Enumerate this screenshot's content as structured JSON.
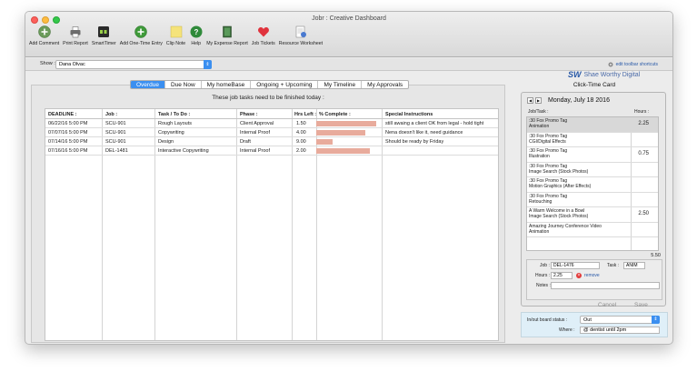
{
  "window": {
    "title": "Jobr : Creative Dashboard"
  },
  "toolbar": [
    {
      "label": "Add Comment",
      "icon": "add-comment-icon"
    },
    {
      "label": "Print Report",
      "icon": "printer-icon"
    },
    {
      "label": "SmartTimer",
      "icon": "timer-icon"
    },
    {
      "label": "Add One-Time Entry",
      "icon": "add-entry-icon"
    },
    {
      "label": "Clip Note",
      "icon": "sticky-note-icon"
    },
    {
      "label": "Help",
      "icon": "help-icon"
    },
    {
      "label": "My Expense Report",
      "icon": "expense-book-icon"
    },
    {
      "label": "Job Tickets",
      "icon": "heart-ticket-icon"
    },
    {
      "label": "Resource Worksheet",
      "icon": "worksheet-icon"
    }
  ],
  "showbar": {
    "label": "Show :",
    "selected": "Dana Olvac",
    "shortcuts": "edit toolbar shortcuts"
  },
  "tabs": [
    "Overdue",
    "Due Now",
    "My homeBase",
    "Ongoing + Upcoming",
    "My Timeline",
    "My Approvals"
  ],
  "main": {
    "subtitle": "These job tasks need to be finished today :",
    "columns": [
      "DEADLINE :",
      "Job :",
      "Task / To Do :",
      "Phase :",
      "Hrs Left :",
      "% Complete :",
      "Special Instructions"
    ],
    "rows": [
      {
        "deadline": "06/22/16  5:00 PM",
        "job": "SCU-901",
        "task": "Rough Layouts",
        "phase": "Client Approval",
        "hrs": "1.50",
        "pct": 1.0,
        "notes": "still awaing a client OK from legal - hold tight"
      },
      {
        "deadline": "07/07/16  5:00 PM",
        "job": "SCU-901",
        "task": "Copywriting",
        "phase": "Internal Proof",
        "hrs": "4.00",
        "pct": 0.82,
        "notes": "Nena doesn't like it, need guidance"
      },
      {
        "deadline": "07/14/16  5:00 PM",
        "job": "SCU-901",
        "task": "Design",
        "phase": "Draft",
        "hrs": "9.00",
        "pct": 0.28,
        "notes": "Should be ready by Friday"
      },
      {
        "deadline": "07/16/16  5:00 PM",
        "job": "DEL-1481",
        "task": "Interactive Copywriting",
        "phase": "Internal Proof",
        "hrs": "2.00",
        "pct": 0.9,
        "notes": ""
      }
    ]
  },
  "side": {
    "logo": "Shae Worthy Digital",
    "logo_mark": "SW",
    "card_title": "Click-Time Card",
    "date": "Monday, July 18 2016",
    "col_job": "Job/Task :",
    "col_hours": "Hours :",
    "entries": [
      {
        "line1": ":30 Fox Promo Tag",
        "line2": "Animation",
        "hours": "2.25"
      },
      {
        "line1": ":30 Fox Promo Tag",
        "line2": "CGI/Digital Effects",
        "hours": ""
      },
      {
        "line1": ":30 Fox Promo Tag",
        "line2": "Illustration",
        "hours": "0.75"
      },
      {
        "line1": ":30 Fox Promo Tag",
        "line2": "Image Search (Stock Photos)",
        "hours": ""
      },
      {
        "line1": ":30 Fox Promo Tag",
        "line2": "Motion Graphics (After Effects)",
        "hours": ""
      },
      {
        "line1": ":30 Fox Promo Tag",
        "line2": "Retouching",
        "hours": ""
      },
      {
        "line1": "A Warm Welcome in a Bowl",
        "line2": "Image Search (Stock Photos)",
        "hours": "2.50"
      },
      {
        "line1": "Amazing Journey Conference Video",
        "line2": "Animation",
        "hours": ""
      }
    ],
    "total": "5.50",
    "entry": {
      "job_label": "Job :",
      "job_value": "DEL-1476",
      "task_label": "Task :",
      "task_value": "ANIM",
      "hours_label": "Hours :",
      "hours_value": "2.25",
      "remove_label": "remove",
      "notes_label": "Notes :",
      "notes_value": ""
    },
    "cancel": "Cancel",
    "save": "Save",
    "status_label": "In/out board status :",
    "status_value": "Out",
    "where_label": "Where :",
    "where_value": "@ dentist until 2pm"
  }
}
